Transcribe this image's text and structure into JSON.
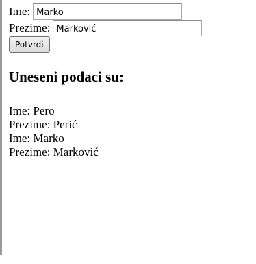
{
  "form": {
    "ime_label": "Ime:",
    "ime_value": "Marko",
    "prezime_label": "Prezime:",
    "prezime_value": "Marković",
    "submit_label": "Potvrdi"
  },
  "results": {
    "heading": "Uneseni podaci su:",
    "lines": [
      "Ime: Pero",
      "Prezime: Perić",
      "Ime: Marko",
      "Prezime: Marković"
    ]
  }
}
